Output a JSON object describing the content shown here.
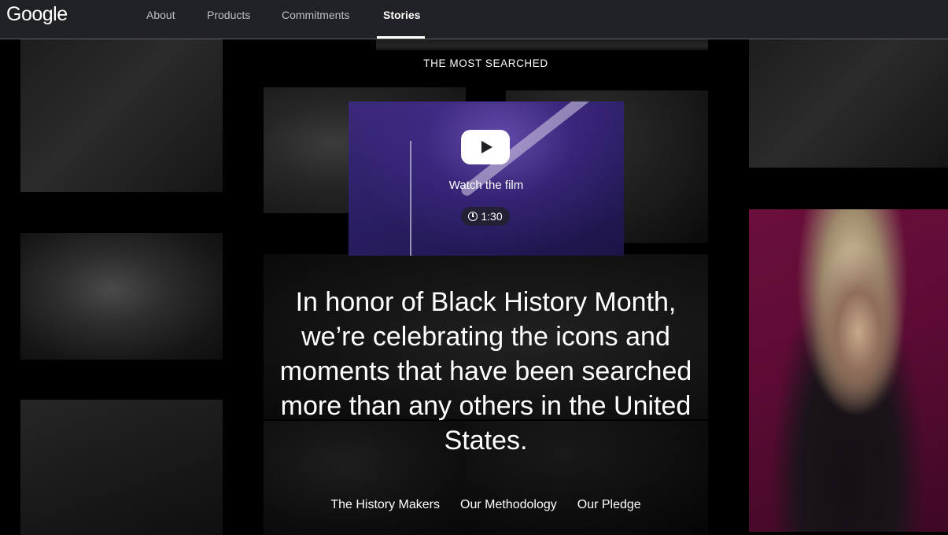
{
  "header": {
    "logo": "Google",
    "nav": [
      {
        "label": "About"
      },
      {
        "label": "Products"
      },
      {
        "label": "Commitments"
      },
      {
        "label": "Stories",
        "active": true
      }
    ]
  },
  "main": {
    "eyebrow": "THE MOST SEARCHED",
    "video": {
      "play_icon": "play-icon",
      "watch_label": "Watch the film",
      "clock_icon": "clock-icon",
      "duration": "1:30"
    },
    "headline": "In honor of Black History Month, we’re celebrating the icons and moments that have been searched more than any others in the United States.",
    "links": [
      {
        "label": "The History Makers"
      },
      {
        "label": "Our Methodology"
      },
      {
        "label": "Our Pledge"
      }
    ]
  },
  "colors": {
    "header_bg": "#202124",
    "page_bg": "#000000",
    "accent_pink": "#6b0f3c",
    "video_purple": "#2c1f66"
  }
}
